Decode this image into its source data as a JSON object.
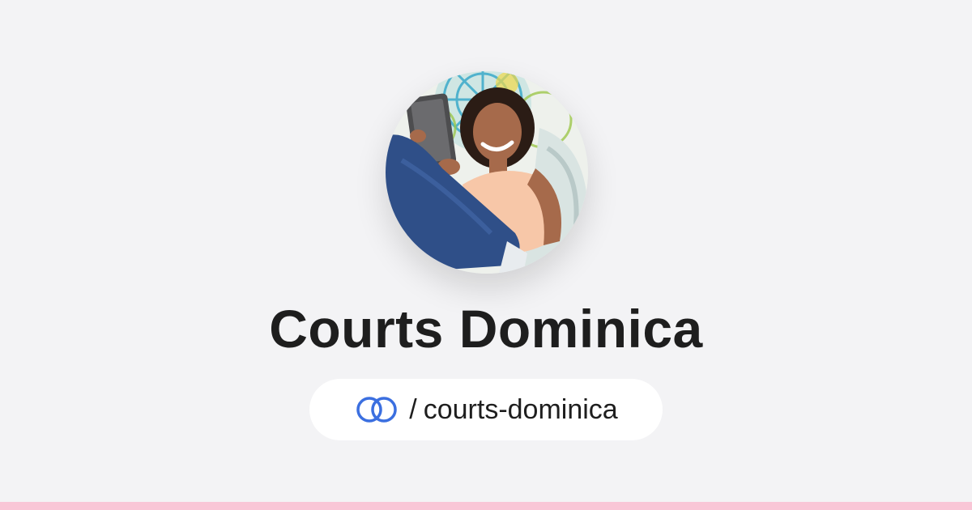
{
  "profile": {
    "display_name": "Courts Dominica",
    "handle_separator": "/",
    "handle": "courts-dominica"
  },
  "icons": {
    "link_icon": "interlocking-rings-icon",
    "avatar": "woman-reading-tablet-photo"
  },
  "colors": {
    "background": "#f3f3f5",
    "text": "#1e1e1e",
    "accent_blue": "#3b6fe0",
    "bottom_bar": "#f9c6d6",
    "pill": "#ffffff"
  }
}
